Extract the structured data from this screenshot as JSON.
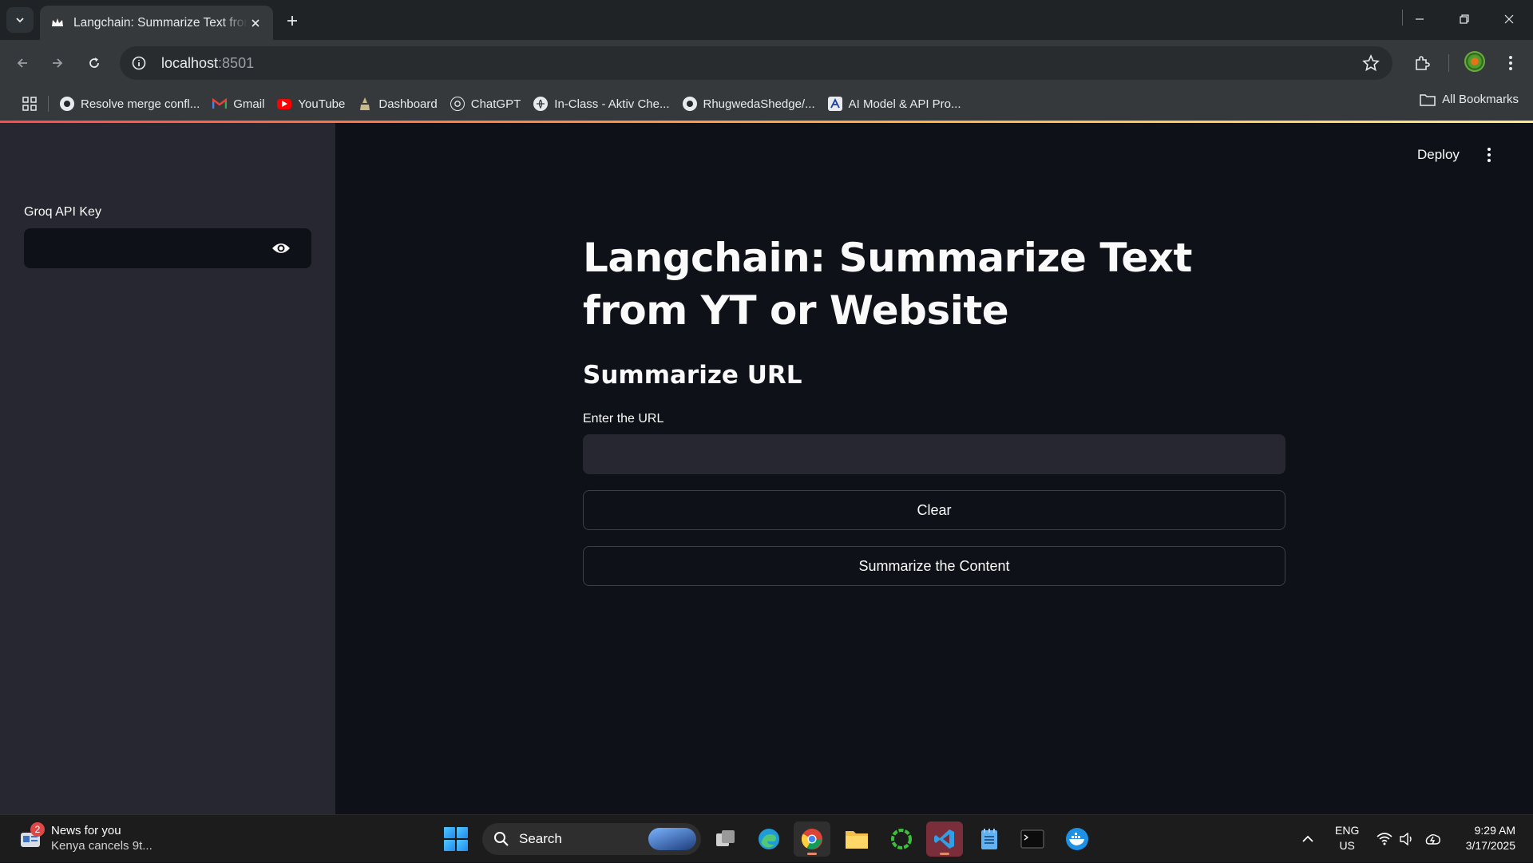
{
  "browser": {
    "tab_title": "Langchain: Summarize Text from YT or Website",
    "url_host": "localhost",
    "url_port": ":8501",
    "bookmarks": [
      {
        "label": "Resolve merge confl...",
        "icon": "github-icon"
      },
      {
        "label": "Gmail",
        "icon": "gmail-icon"
      },
      {
        "label": "YouTube",
        "icon": "youtube-icon"
      },
      {
        "label": "Dashboard",
        "icon": "dashboard-icon"
      },
      {
        "label": "ChatGPT",
        "icon": "chatgpt-icon"
      },
      {
        "label": "In-Class - Aktiv Che...",
        "icon": "globe-icon"
      },
      {
        "label": "RhugwedaShedge/...",
        "icon": "github-icon"
      },
      {
        "label": "AI Model & API Pro...",
        "icon": "artificial-analysis-icon"
      }
    ],
    "all_bookmarks": "All Bookmarks"
  },
  "app": {
    "deploy_label": "Deploy",
    "sidebar": {
      "api_key_label": "Groq API Key",
      "api_key_value": ""
    },
    "title": "Langchain: Summarize Text from YT or Website",
    "subheader": "Summarize URL",
    "url_label": "Enter the URL",
    "url_value": "",
    "clear_button": "Clear",
    "summarize_button": "Summarize the Content"
  },
  "taskbar": {
    "news_title": "News for you",
    "news_subtitle": "Kenya cancels 9t...",
    "news_badge": "2",
    "search_label": "Search",
    "lang_top": "ENG",
    "lang_bottom": "US",
    "time": "9:29 AM",
    "date": "3/17/2025"
  },
  "colors": {
    "app_bg": "#0e1117",
    "sidebar_bg": "#262730",
    "input_bg": "#262730",
    "text": "#fafafa"
  }
}
